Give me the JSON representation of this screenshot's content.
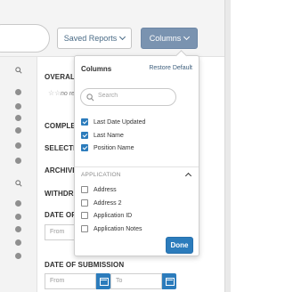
{
  "toolbar": {
    "saved_reports_label": "Saved Reports",
    "columns_label": "Columns"
  },
  "filters": {
    "overall_label": "OVERALL",
    "no_results_text": "no re",
    "completed_label": "COMPLET",
    "selected_label": "SELECTED",
    "archived_label": "ARCHIVED",
    "withdrawn_label": "WITHDRA",
    "date_of_label": "DATE OF F",
    "from_placeholder_1": "From",
    "date_of_submission_label": "DATE OF SUBMISSION",
    "from_placeholder_2": "From",
    "to_placeholder": "To"
  },
  "columns_dropdown": {
    "title": "Columns",
    "restore_default": "Restore Default",
    "search_placeholder": "Search",
    "selected_items": [
      {
        "label": "Last Date Updated",
        "checked": true
      },
      {
        "label": "Last Name",
        "checked": true
      },
      {
        "label": "Position Name",
        "checked": true
      }
    ],
    "section_label": "APPLICATION",
    "section_items": [
      {
        "label": "Address",
        "checked": false
      },
      {
        "label": "Address 2",
        "checked": false
      },
      {
        "label": "Application ID",
        "checked": false
      },
      {
        "label": "Application Notes",
        "checked": false
      }
    ],
    "done_label": "Done"
  },
  "colors": {
    "accent": "#2c7cbc",
    "columns_button": "#7a93b0"
  }
}
